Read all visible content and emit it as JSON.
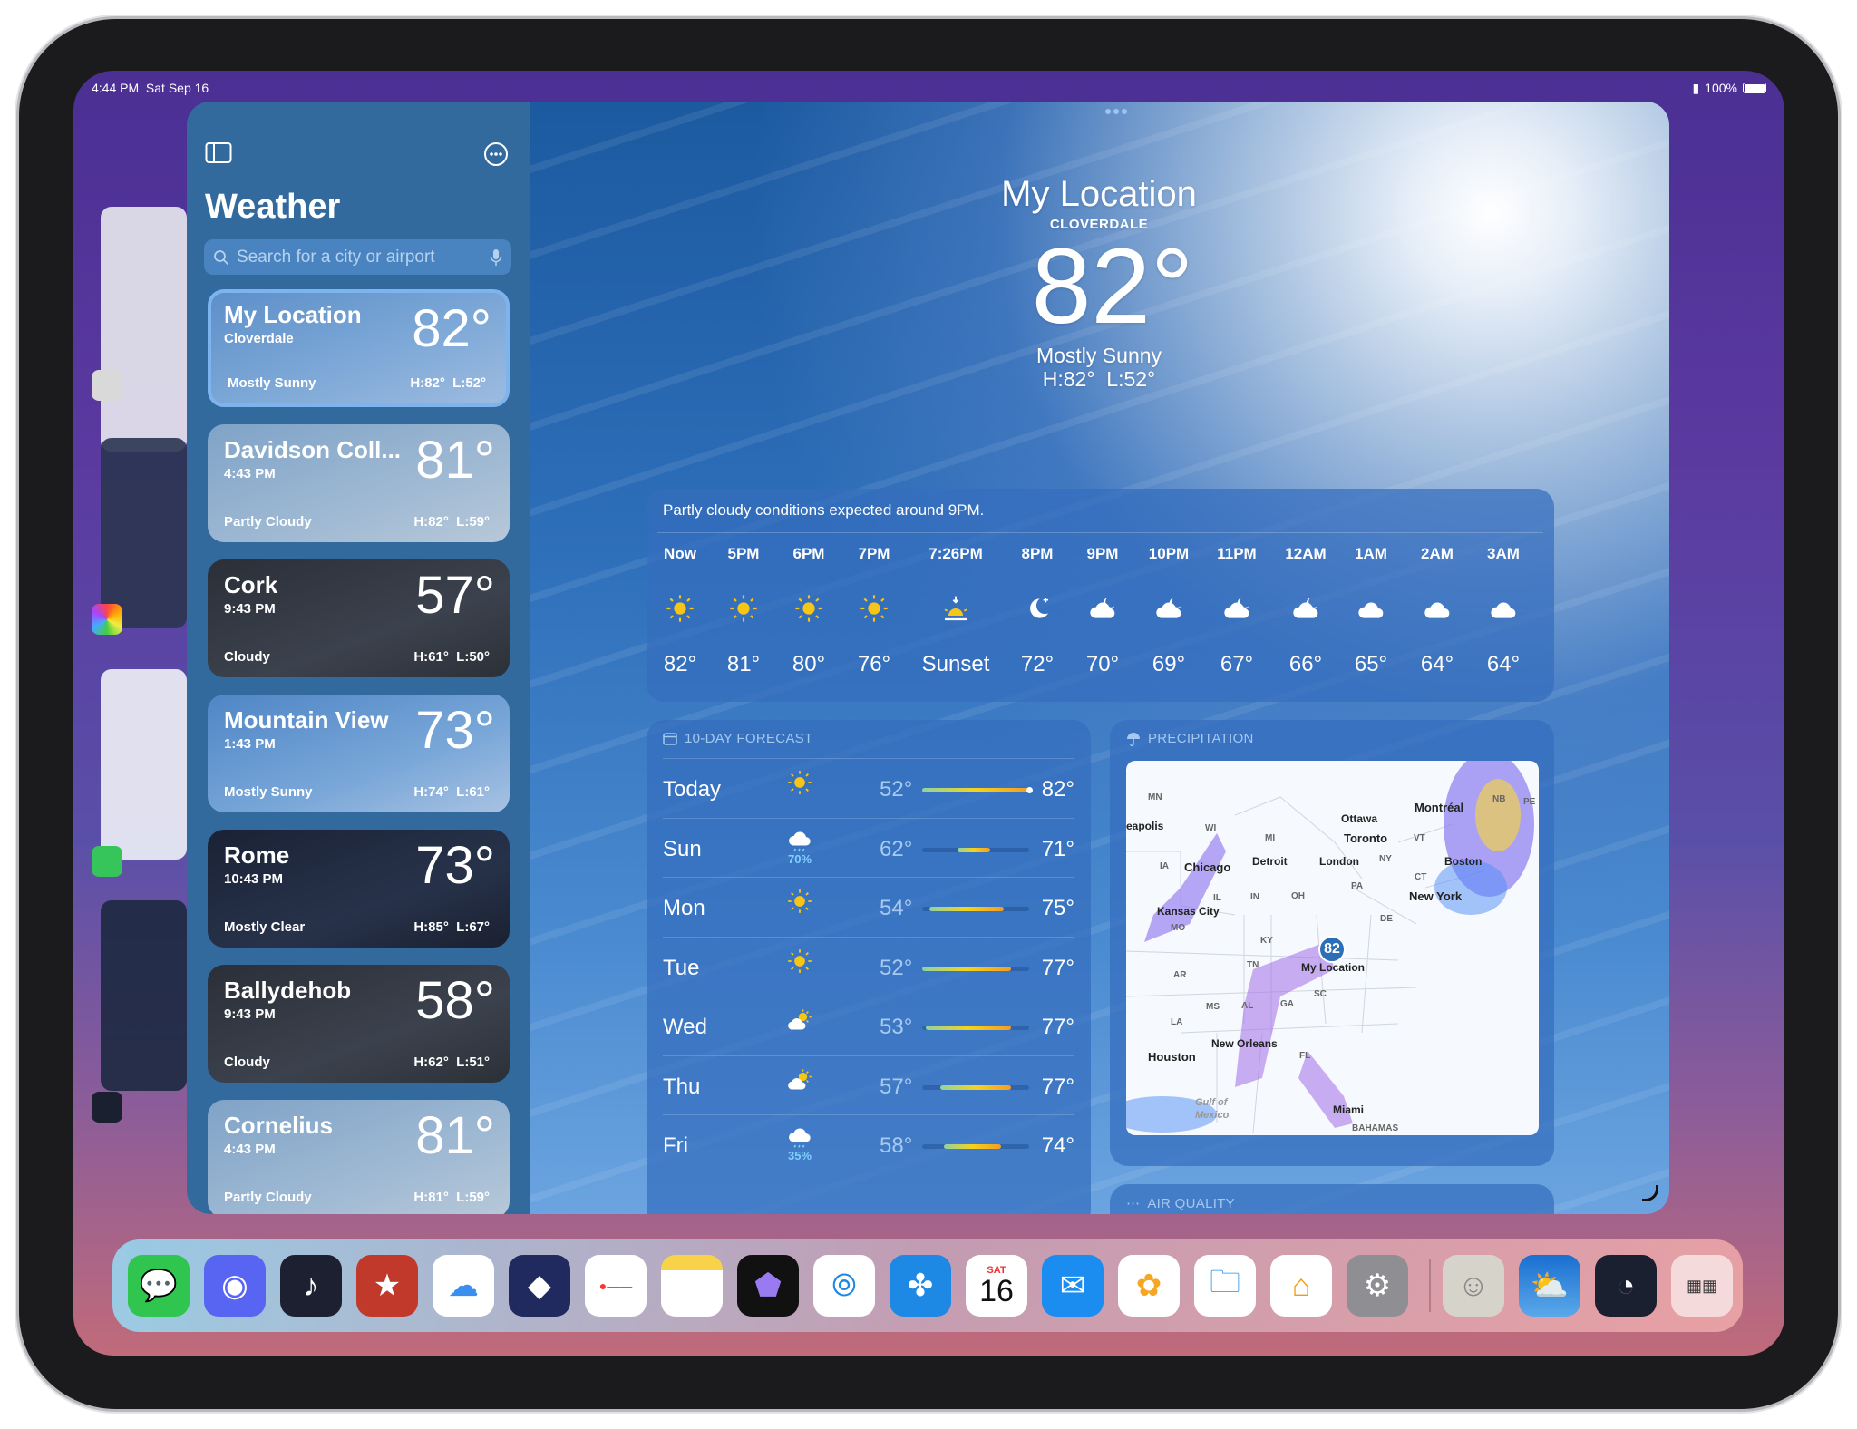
{
  "status": {
    "time": "4:44 PM",
    "date": "Sat Sep 16",
    "battery": "100%",
    "battery_level": 1.0
  },
  "sidebar": {
    "title": "Weather",
    "search_placeholder": "Search for a city or airport",
    "icons": {
      "toggle": "sidebar-toggle-icon",
      "more": "ellipsis-circle-icon",
      "search": "magnifying-glass-icon",
      "mic": "microphone-icon"
    },
    "cities": [
      {
        "name": "My Location",
        "sub": "Cloverdale",
        "temp": "82°",
        "cond": "Mostly Sunny",
        "hl": "H:82°  L:52°",
        "theme": "sunny",
        "selected": true
      },
      {
        "name": "Davidson Coll...",
        "sub": "4:43 PM",
        "temp": "81°",
        "cond": "Partly Cloudy",
        "hl": "H:82°  L:59°",
        "theme": "partly"
      },
      {
        "name": "Cork",
        "sub": "9:43 PM",
        "temp": "57°",
        "cond": "Cloudy",
        "hl": "H:61°  L:50°",
        "theme": "cloudy-night"
      },
      {
        "name": "Mountain View",
        "sub": "1:43 PM",
        "temp": "73°",
        "cond": "Mostly Sunny",
        "hl": "H:74°  L:61°",
        "theme": "sunny2"
      },
      {
        "name": "Rome",
        "sub": "10:43 PM",
        "temp": "73°",
        "cond": "Mostly Clear",
        "hl": "H:85°  L:67°",
        "theme": "night"
      },
      {
        "name": "Ballydehob",
        "sub": "9:43 PM",
        "temp": "58°",
        "cond": "Cloudy",
        "hl": "H:62°  L:51°",
        "theme": "cloudy-night"
      },
      {
        "name": "Cornelius",
        "sub": "4:43 PM",
        "temp": "81°",
        "cond": "Partly Cloudy",
        "hl": "H:81°  L:59°",
        "theme": "partly"
      }
    ]
  },
  "current": {
    "title": "My Location",
    "place": "CLOVERDALE",
    "temp": "82°",
    "cond": "Mostly Sunny",
    "hl": "H:82°  L:52°"
  },
  "hourly": {
    "note": "Partly cloudy conditions expected around 9PM.",
    "items": [
      {
        "t": "Now",
        "icon": "sun",
        "v": "82°"
      },
      {
        "t": "5PM",
        "icon": "sun",
        "v": "81°"
      },
      {
        "t": "6PM",
        "icon": "sun",
        "v": "80°"
      },
      {
        "t": "7PM",
        "icon": "sun",
        "v": "76°"
      },
      {
        "t": "7:26PM",
        "icon": "sunset",
        "v": "Sunset"
      },
      {
        "t": "8PM",
        "icon": "moon-stars",
        "v": "72°"
      },
      {
        "t": "9PM",
        "icon": "cloud-moon",
        "v": "70°"
      },
      {
        "t": "10PM",
        "icon": "cloud-moon",
        "v": "69°"
      },
      {
        "t": "11PM",
        "icon": "cloud-moon",
        "v": "67°"
      },
      {
        "t": "12AM",
        "icon": "cloud-moon",
        "v": "66°"
      },
      {
        "t": "1AM",
        "icon": "cloud",
        "v": "65°"
      },
      {
        "t": "2AM",
        "icon": "cloud",
        "v": "64°"
      },
      {
        "t": "3AM",
        "icon": "cloud",
        "v": "64°"
      }
    ]
  },
  "ten_day": {
    "header": "10-DAY FORECAST",
    "icon": "calendar-icon",
    "range": [
      52,
      82
    ],
    "days": [
      {
        "d": "Today",
        "icon": "sun",
        "lo": "52°",
        "hi": "82°",
        "lo_v": 52,
        "hi_v": 82,
        "current": 82
      },
      {
        "d": "Sun",
        "icon": "cloud-rain",
        "pop": "70%",
        "lo": "62°",
        "hi": "71°",
        "lo_v": 62,
        "hi_v": 71
      },
      {
        "d": "Mon",
        "icon": "sun",
        "lo": "54°",
        "hi": "75°",
        "lo_v": 54,
        "hi_v": 75
      },
      {
        "d": "Tue",
        "icon": "sun",
        "lo": "52°",
        "hi": "77°",
        "lo_v": 52,
        "hi_v": 77
      },
      {
        "d": "Wed",
        "icon": "cloud-sun",
        "lo": "53°",
        "hi": "77°",
        "lo_v": 53,
        "hi_v": 77
      },
      {
        "d": "Thu",
        "icon": "cloud-sun",
        "lo": "57°",
        "hi": "77°",
        "lo_v": 57,
        "hi_v": 77
      },
      {
        "d": "Fri",
        "icon": "cloud-rain",
        "pop": "35%",
        "lo": "58°",
        "hi": "74°",
        "lo_v": 58,
        "hi_v": 74
      }
    ]
  },
  "precipitation": {
    "header": "PRECIPITATION",
    "icon": "umbrella-icon",
    "pin_temp": "82",
    "labels": {
      "mn": "MN",
      "minneapolis": "eapolis",
      "wi": "WI",
      "mi": "MI",
      "ottawa": "Ottawa",
      "montreal": "Montréal",
      "toronto": "Toronto",
      "ia": "IA",
      "chicago": "Chicago",
      "detroit": "Detroit",
      "london": "London",
      "ny": "NY",
      "vt": "VT",
      "boston": "Boston",
      "ct": "CT",
      "pa": "PA",
      "il": "IL",
      "in": "IN",
      "oh": "OH",
      "newyork": "New York",
      "kansascity": "Kansas City",
      "mo": "MO",
      "de": "DE",
      "ky": "KY",
      "tn": "TN",
      "mylocation": "My Location",
      "ar": "AR",
      "sc": "SC",
      "ms": "MS",
      "al": "AL",
      "ga": "GA",
      "la": "LA",
      "neworleans": "New Orleans",
      "houston": "Houston",
      "fl": "FL",
      "gulf": "Gulf of Mexico",
      "miami": "Miami",
      "bahamas": "BAHAMAS",
      "nb": "NB",
      "pe": "PE"
    }
  },
  "air_quality": {
    "header": "AIR QUALITY",
    "icon": "aqi-dots-icon"
  },
  "dock": {
    "calendar_day": "SAT",
    "calendar_date": "16",
    "apps": [
      "messages",
      "discord",
      "music-player",
      "fantastical",
      "icloud-drive",
      "shortcuts",
      "reminders",
      "notes",
      "obsidian",
      "safari",
      "testflight",
      "calendar",
      "mail",
      "photos",
      "files",
      "home",
      "settings",
      "contacts",
      "weather",
      "speedtest",
      "app-library"
    ]
  },
  "colors": {
    "accent": "#2c6fb7",
    "sun": "#f6c516",
    "bar_cool": "#8fd3a5",
    "bar_warm": "#f39c26"
  }
}
